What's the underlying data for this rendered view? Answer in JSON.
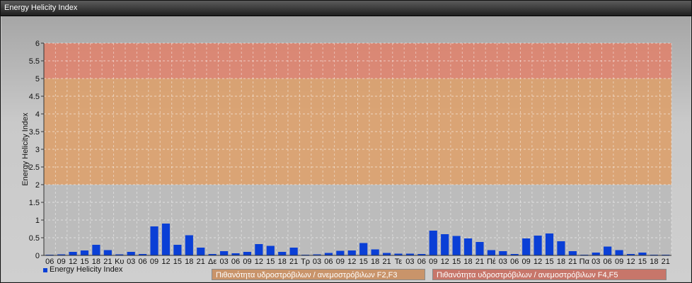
{
  "window": {
    "title": "Energy Helicity Index"
  },
  "legend": {
    "series_label": "Energy Helicity Index",
    "band_labels": [
      "Πιθανότητα υδροστρόβιλων / ανεμοστρόβιλων F2,F3",
      "Πιθανότητα υδροστρόβιλων / ανεμοστρόβιλων F4,F5"
    ]
  },
  "colors": {
    "bar": "#0a3fd6",
    "band_high": "#e0806a",
    "band_mid": "#dd9e66",
    "band_low": "#b9b9b9"
  },
  "chart_data": {
    "type": "bar",
    "ylabel": "Energy Helicity Index",
    "ylim": [
      0,
      6
    ],
    "yticks": [
      "0",
      "0.5",
      "1",
      "1.5",
      "2",
      "2.5",
      "3",
      "3.5",
      "4",
      "4.5",
      "5",
      "5.5",
      "6"
    ],
    "grid": true,
    "bands": [
      {
        "from": 0,
        "to": 2,
        "color": "#b9b9b9"
      },
      {
        "from": 2,
        "to": 5,
        "color": "#dd9e66"
      },
      {
        "from": 5,
        "to": 6,
        "color": "#e0806a"
      }
    ],
    "categories": [
      "06",
      "09",
      "12",
      "15",
      "18",
      "21",
      "Κυ",
      "03",
      "06",
      "09",
      "12",
      "15",
      "18",
      "21",
      "Δε",
      "03",
      "06",
      "09",
      "12",
      "15",
      "18",
      "21",
      "Τρ",
      "03",
      "06",
      "09",
      "12",
      "15",
      "18",
      "21",
      "Τε",
      "03",
      "06",
      "09",
      "12",
      "15",
      "18",
      "21",
      "Πέ",
      "03",
      "06",
      "09",
      "12",
      "15",
      "18",
      "21",
      "Πα",
      "03",
      "06",
      "09",
      "12",
      "15",
      "18",
      "21"
    ],
    "series": [
      {
        "name": "Energy Helicity Index",
        "values": [
          0.02,
          0.03,
          0.1,
          0.14,
          0.3,
          0.15,
          0.03,
          0.1,
          0.04,
          0.82,
          0.9,
          0.3,
          0.57,
          0.22,
          0.04,
          0.12,
          0.06,
          0.1,
          0.32,
          0.27,
          0.1,
          0.22,
          0.02,
          0.03,
          0.07,
          0.13,
          0.14,
          0.35,
          0.17,
          0.07,
          0.05,
          0.05,
          0.04,
          0.7,
          0.6,
          0.55,
          0.48,
          0.38,
          0.15,
          0.12,
          0.04,
          0.48,
          0.56,
          0.62,
          0.4,
          0.12,
          0.02,
          0.08,
          0.25,
          0.15,
          0.04,
          0.08,
          0.02,
          0.02
        ]
      }
    ]
  }
}
